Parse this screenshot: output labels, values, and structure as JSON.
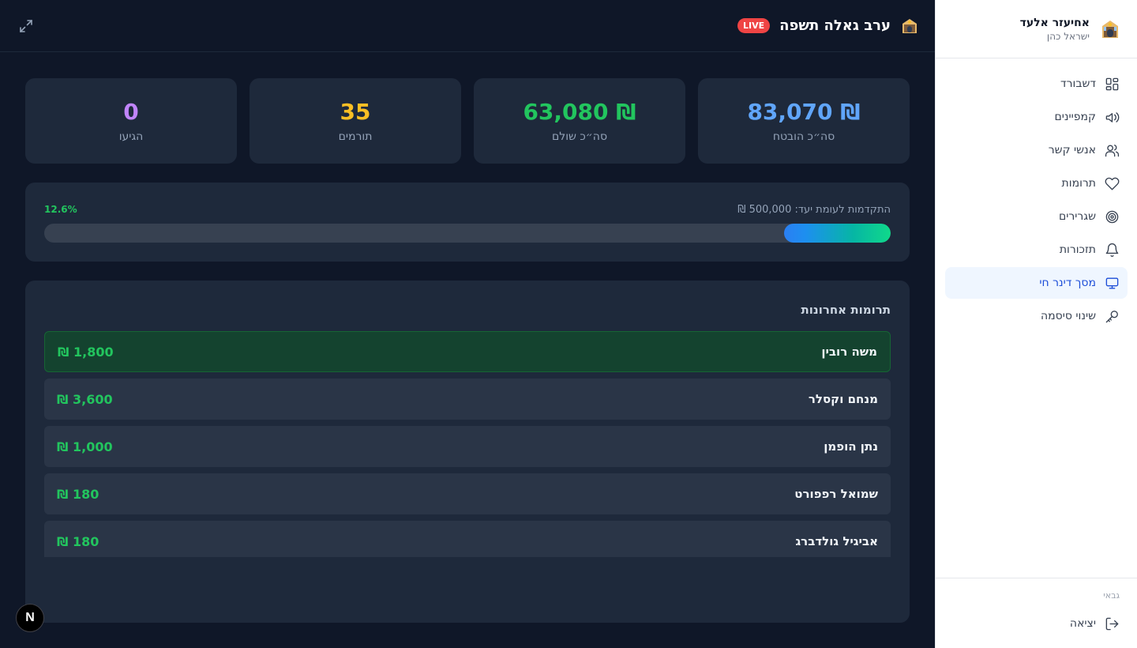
{
  "sidebar": {
    "user": {
      "name": "אחיעזר אלעד",
      "subtitle": "ישראל כהן",
      "avatar_icon": "synagogue-icon"
    },
    "items": [
      {
        "label": "דשבורד",
        "icon": "grid-icon"
      },
      {
        "label": "קמפיינים",
        "icon": "megaphone-icon"
      },
      {
        "label": "אנשי קשר",
        "icon": "users-icon"
      },
      {
        "label": "תרומות",
        "icon": "heart-icon"
      },
      {
        "label": "שגרירים",
        "icon": "target-icon"
      },
      {
        "label": "תזכורות",
        "icon": "bell-icon"
      },
      {
        "label": "מסך דינר חי",
        "icon": "monitor-icon",
        "active": true
      },
      {
        "label": "שינוי סיסמה",
        "icon": "key-icon"
      }
    ],
    "role": "גבאי",
    "logout": {
      "label": "יציאה",
      "icon": "logout-icon"
    }
  },
  "header": {
    "title": "ערב גאלה תשפה",
    "live": "LIVE",
    "event_icon": "synagogue-icon",
    "expand_icon": "expand-icon"
  },
  "stats": [
    {
      "value": "83,070 ₪",
      "label": "סה״כ הובטח",
      "color": "#60a5fa"
    },
    {
      "value": "63,080 ₪",
      "label": "סה״כ שולם",
      "color": "#22c55e"
    },
    {
      "value": "35",
      "label": "תורמים",
      "color": "#fbbf24"
    },
    {
      "value": "0",
      "label": "הגיעו",
      "color": "#c084fc"
    }
  ],
  "progress": {
    "label": "התקדמות לעומת יעד: 500,000 ₪",
    "percent_text": "12.6%",
    "fraction": 0.126
  },
  "donations": {
    "title": "תרומות אחרונות",
    "rows": [
      {
        "name": "משה רובין",
        "amount": "₪ 1,800",
        "highlight": true
      },
      {
        "name": "מנחם וקסלר",
        "amount": "₪ 3,600"
      },
      {
        "name": "נתן הופמן",
        "amount": "₪ 1,000"
      },
      {
        "name": "שמואל רפפורט",
        "amount": "₪ 180"
      },
      {
        "name": "אביגיל גולדברג",
        "amount": "₪ 180"
      }
    ]
  },
  "next_badge": "N"
}
